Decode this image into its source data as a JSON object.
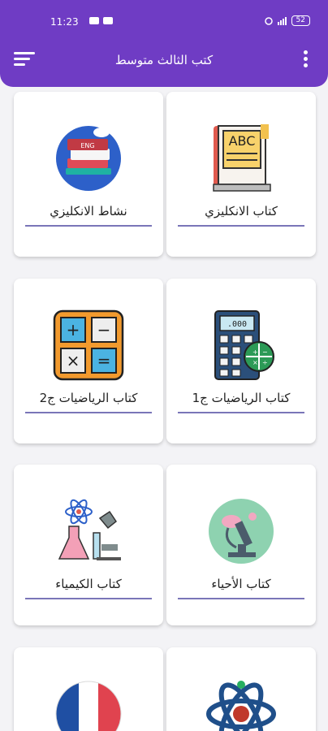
{
  "status": {
    "time": "11:23",
    "battery": "52"
  },
  "appbar": {
    "title": "كتب الثالث متوسط"
  },
  "cards": [
    {
      "label": "كتاب الانكليزي"
    },
    {
      "label": "نشاط الانكليزي"
    },
    {
      "label": "كتاب الرياضيات ج1"
    },
    {
      "label": "كتاب الرياضيات ج2"
    },
    {
      "label": "كتاب الأحياء"
    },
    {
      "label": "كتاب الكيمياء"
    },
    {
      "label": ""
    },
    {
      "label": ""
    }
  ],
  "colors": {
    "appbar": "#6f3cc4",
    "background": "#f3f3f6",
    "underline": "#7a75b8"
  },
  "icons": [
    "abc-book-icon",
    "english-activity-icon",
    "calculator-icon",
    "math-symbols-icon",
    "biology-microscope-icon",
    "chemistry-flask-icon",
    "physics-atom-icon",
    "france-flag-icon"
  ]
}
